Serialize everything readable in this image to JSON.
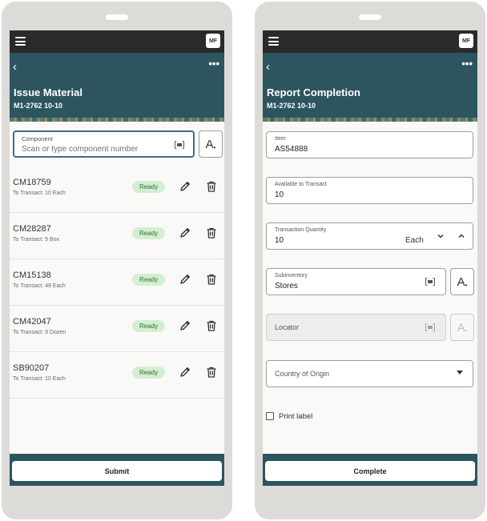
{
  "left": {
    "avatar": "MF",
    "title": "Issue Material",
    "subtitle": "M1-2762 10-10",
    "component": {
      "label": "Component",
      "placeholder": "Scan or type component number"
    },
    "items": [
      {
        "code": "CM18759",
        "detail": "To Transact: 10 Each",
        "status": "Ready"
      },
      {
        "code": "CM28287",
        "detail": "To Transact: 5 Box",
        "status": "Ready"
      },
      {
        "code": "CM15138",
        "detail": "To Transact: 49 Each",
        "status": "Ready"
      },
      {
        "code": "CM42047",
        "detail": "To Transact: 9 Dozen",
        "status": "Ready"
      },
      {
        "code": "SB90207",
        "detail": "To Transact: 10 Each",
        "status": "Ready"
      }
    ],
    "submit_label": "Submit"
  },
  "right": {
    "avatar": "MF",
    "title": "Report Completion",
    "subtitle": "M1-2762 10-10",
    "item": {
      "label": "Item",
      "value": "AS54888"
    },
    "available": {
      "label": "Available to Transact",
      "value": "10"
    },
    "quantity": {
      "label": "Transaction Quantity",
      "value": "10",
      "uom": "Each"
    },
    "subinventory": {
      "label": "Subinventory",
      "value": "Stores"
    },
    "locator": {
      "label": "Locator"
    },
    "country": {
      "label": "Country of Origin"
    },
    "print_label": "Print label",
    "complete_label": "Complete"
  },
  "icons": {
    "menu": "hamburger-icon",
    "back": "chevron-left-icon",
    "more": "ellipsis-icon",
    "scan": "barcode-scan-icon",
    "font": "text-size-icon",
    "edit": "pencil-icon",
    "delete": "trash-icon"
  },
  "colors": {
    "header": "#2c5560",
    "appbar": "#2a2a2a",
    "badge_bg": "#d3efd1",
    "badge_text": "#3a6b38",
    "focus_border": "#3b6f85"
  }
}
